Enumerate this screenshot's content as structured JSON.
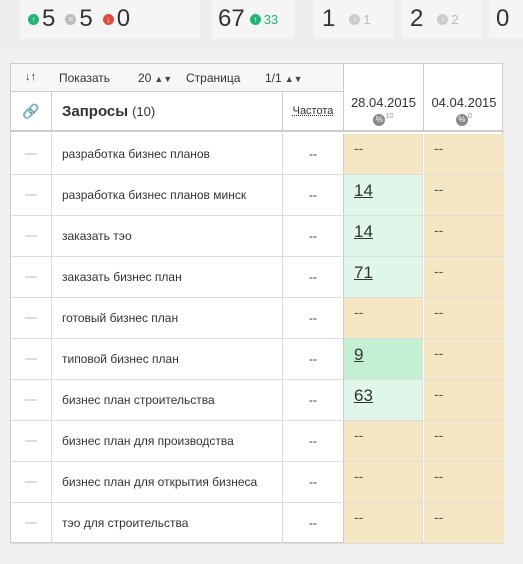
{
  "stats": {
    "up_count": "5",
    "same_count": "5",
    "down_count": "0",
    "total": "67",
    "total_up": "33",
    "card3_value": "1",
    "card3_delta": "1",
    "card4_value": "2",
    "card4_delta": "2",
    "card5_value": "0"
  },
  "toolbar": {
    "show_label": "Показать",
    "show_value": "20",
    "page_label": "Страница",
    "page_value": "1/1"
  },
  "table": {
    "queries_label": "Запросы",
    "queries_count": "(10)",
    "frequency_label": "Частота",
    "dates": [
      {
        "date": "28.04.2015",
        "badge": "10"
      },
      {
        "date": "04.04.2015",
        "badge": "0"
      }
    ],
    "rows": [
      {
        "query": "разработка бизнес планов",
        "freq": "--",
        "p1": "--",
        "p2": "--"
      },
      {
        "query": "разработка бизнес планов минск",
        "freq": "--",
        "p1": "14",
        "p2": "--"
      },
      {
        "query": "заказать тэо",
        "freq": "--",
        "p1": "14",
        "p2": "--"
      },
      {
        "query": "заказать бизнес план",
        "freq": "--",
        "p1": "71",
        "p2": "--"
      },
      {
        "query": "готовый бизнес план",
        "freq": "--",
        "p1": "--",
        "p2": "--"
      },
      {
        "query": "типовой бизнес план",
        "freq": "--",
        "p1": "9",
        "p2": "--"
      },
      {
        "query": "бизнес план строительства",
        "freq": "--",
        "p1": "63",
        "p2": "--"
      },
      {
        "query": "бизнес план для производства",
        "freq": "--",
        "p1": "--",
        "p2": "--"
      },
      {
        "query": "бизнес план для открытия бизнеса",
        "freq": "--",
        "p1": "--",
        "p2": "--"
      },
      {
        "query": "тэо для строительства",
        "freq": "--",
        "p1": "--",
        "p2": "--"
      }
    ]
  },
  "colors": {
    "beige": "#f5e6c4",
    "green_light": "#dff6e9",
    "green_mid": "#c3efd2",
    "up": "#22b573",
    "down": "#e04a3a"
  }
}
